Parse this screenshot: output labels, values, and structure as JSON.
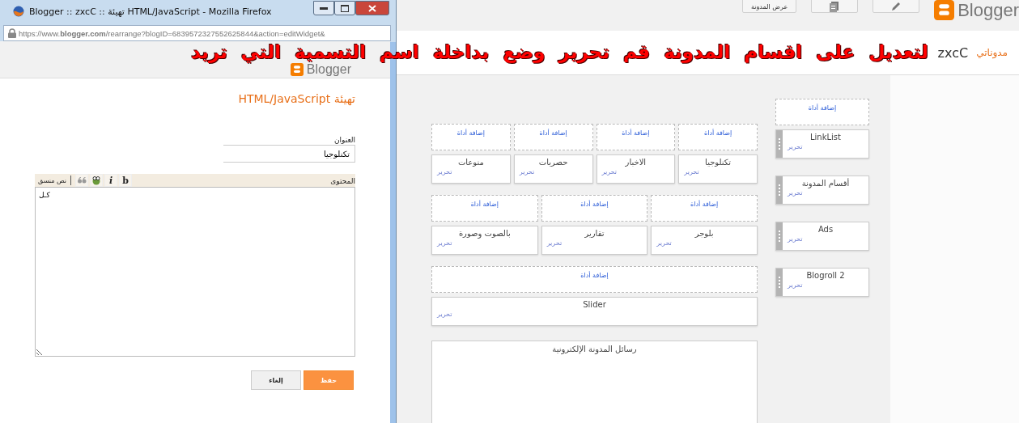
{
  "page": {
    "view_button": "عرض المدونة",
    "logo": "Blogger",
    "nav_link": "مدوناتي",
    "blog_name": "zxcC",
    "main_rows": [
      {
        "add_labels": [
          "إضافة أداة",
          "إضافة أداة",
          "إضافة أداة",
          "إضافة أداة"
        ],
        "widgets": [
          {
            "title": "تكنلوجيا",
            "edit": "تحرير"
          },
          {
            "title": "الاخبار",
            "edit": "تحرير"
          },
          {
            "title": "حصريات",
            "edit": "تحرير"
          },
          {
            "title": "منوعات",
            "edit": "تحرير"
          }
        ]
      },
      {
        "add_labels": [
          "إضافة أداة",
          "إضافة أداة",
          "إضافة أداة"
        ],
        "widgets": [
          {
            "title": "بلوجر",
            "edit": "تحرير"
          },
          {
            "title": "تقارير",
            "edit": "تحرير"
          },
          {
            "title": "بالصوت وصورة",
            "edit": "تحرير"
          }
        ]
      },
      {
        "add_labels": [
          "إضافة أداة"
        ],
        "widgets": [
          {
            "title": "Slider",
            "edit": "تحرير"
          }
        ]
      }
    ],
    "email_widget": "رسائل المدونة الإلكترونية",
    "sidebar": {
      "add_label": "إضافة أداة",
      "widgets": [
        {
          "title": "LinkList",
          "edit": "تحرير"
        },
        {
          "title": "أقسام المدونة",
          "edit": "تحرير"
        },
        {
          "title": "Ads",
          "edit": "تحرير"
        },
        {
          "title": "Blogroll 2",
          "edit": "تحرير"
        }
      ]
    }
  },
  "popup": {
    "title": "Blogger :: zxcC :: تهيئة HTML/JavaScript - Mozilla Firefox",
    "url": "https://www.**blogger.com**/rearrange?blogID=6839572327552625844&action=editWidget&",
    "logo": "Blogger",
    "heading": "تهيئة HTML/JavaScript",
    "title_label": "العنوان",
    "title_value": "تكنلوجيا",
    "content_label": "المحتوى",
    "toolbar": [
      {
        "kind": "bold",
        "label": "b"
      },
      {
        "kind": "italic",
        "label": "i"
      },
      {
        "kind": "image"
      },
      {
        "kind": "quote"
      }
    ],
    "rich_text": "نص منسق",
    "content_value": "كـل",
    "buttons": [
      {
        "kind": "primary",
        "label": "حفظ"
      },
      {
        "kind": "secondary",
        "label": "إلغاء"
      }
    ]
  },
  "annotation": "لتعديل على اقسام المدونة قم تحرير وضع بداخلة اسم التسمية التي تريد"
}
